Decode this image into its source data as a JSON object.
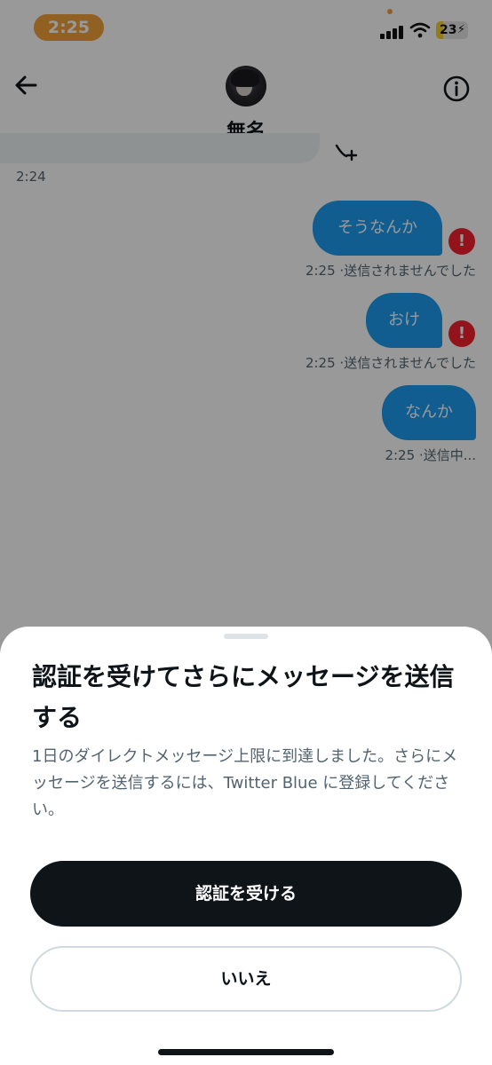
{
  "status_bar": {
    "time": "2:25",
    "battery_percent": "23",
    "battery_level": 0.23,
    "accent_color": "#f0a23a"
  },
  "header": {
    "contact_name": "無名",
    "back_icon": "arrow-left-icon",
    "info_icon": "info-circle-icon"
  },
  "conversation": {
    "received_timestamp": "2:24",
    "messages": [
      {
        "text": "そうなんか",
        "time": "2:25",
        "status": "·送信されませんでした",
        "error": true
      },
      {
        "text": "おけ",
        "time": "2:25",
        "status": "·送信されませんでした",
        "error": true
      },
      {
        "text": "なんか",
        "time": "2:25",
        "status": "·送信中...",
        "error": false
      }
    ],
    "error_glyph": "!",
    "bubble_color": "#1d9bf0",
    "error_color": "#f4212e"
  },
  "sheet": {
    "title": "認証を受けてさらにメッセージを送信する",
    "description": "1日のダイレクトメッセージ上限に到達しました。さらにメッセージを送信するには、Twitter Blue に登録してください。",
    "primary_button": "認証を受ける",
    "secondary_button": "いいえ"
  }
}
